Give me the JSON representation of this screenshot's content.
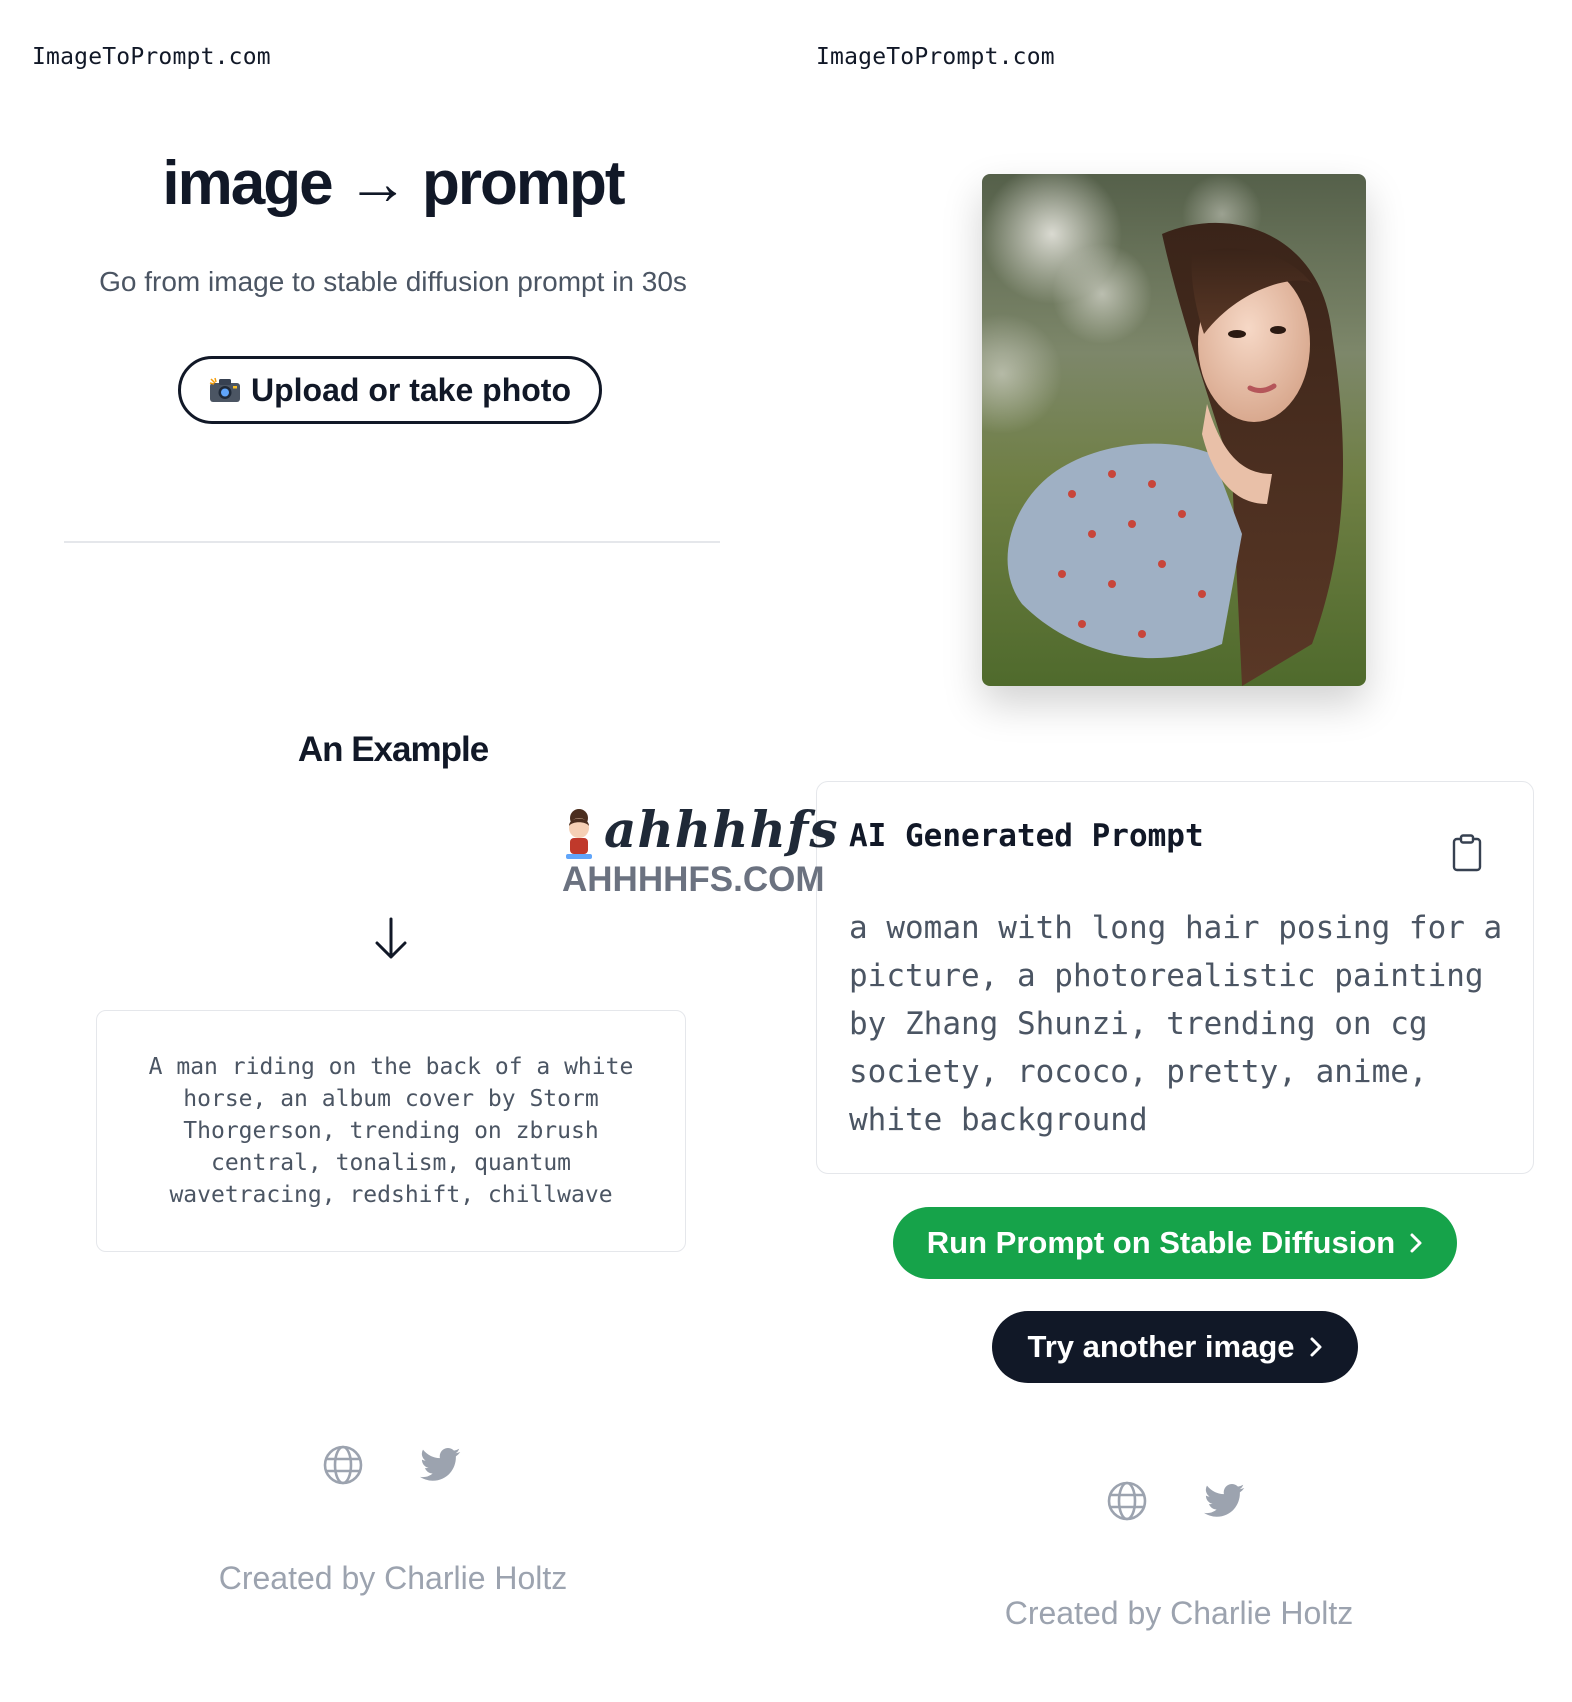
{
  "left": {
    "site_name": "ImageToPrompt.com",
    "hero": {
      "title": "image → prompt",
      "subtitle": "Go from image to stable diffusion prompt in 30s",
      "upload_label": "Upload or take photo",
      "upload_icon": "camera-icon"
    },
    "example": {
      "title": "An Example",
      "arrow_icon": "arrow-down-icon",
      "prompt": "A man riding on the back of a white horse, an album cover by Storm Thorgerson, trending on zbrush central, tonalism, quantum wavetracing, redshift, chillwave"
    },
    "footer": {
      "icons": [
        "globe-icon",
        "twitter-icon"
      ],
      "credit": "Created by Charlie Holtz"
    }
  },
  "right": {
    "site_name": "ImageToPrompt.com",
    "result": {
      "heading": "AI Generated Prompt",
      "copy_icon": "clipboard-icon",
      "prompt": "a woman with long hair posing for a picture, a photorealistic painting by Zhang Shunzi, trending on cg society, rococo, pretty, anime, white background"
    },
    "actions": {
      "run_label": "Run Prompt on Stable Diffusion",
      "try_label": "Try another image"
    },
    "footer": {
      "icons": [
        "globe-icon",
        "twitter-icon"
      ],
      "credit": "Created by Charlie Holtz"
    }
  },
  "watermark": {
    "script": "ahhhhfs",
    "domain": "AHHHHFS.COM"
  },
  "colors": {
    "primary_dark": "#111827",
    "accent_green": "#16a34a",
    "muted_text": "#9ca3af",
    "border": "#e5e7eb"
  }
}
